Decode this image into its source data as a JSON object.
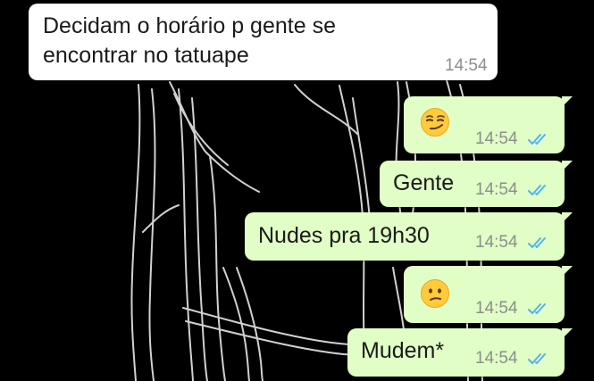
{
  "chat": {
    "messages": [
      {
        "direction": "incoming",
        "text_line_1": "Decidam o horário p gente se",
        "text_line_2": "encontrar no tatuape",
        "time": "14:54"
      },
      {
        "direction": "outgoing",
        "emoji": "smirking-face",
        "time": "14:54",
        "status": "read"
      },
      {
        "direction": "outgoing",
        "text": "Gente",
        "time": "14:54",
        "status": "read"
      },
      {
        "direction": "outgoing",
        "text": "Nudes pra 19h30",
        "time": "14:54",
        "status": "read"
      },
      {
        "direction": "outgoing",
        "emoji": "confused-face",
        "time": "14:54",
        "status": "read"
      },
      {
        "direction": "outgoing",
        "text": "Mudem*",
        "time": "14:54",
        "status": "read"
      }
    ]
  },
  "colors": {
    "background": "#000000",
    "incoming_bubble": "#ffffff",
    "outgoing_bubble": "#e1fec6",
    "read_ticks": "#4fb3f6",
    "timestamp": "#8a8f8c",
    "wallpaper_lines": "#e8e8e8"
  }
}
